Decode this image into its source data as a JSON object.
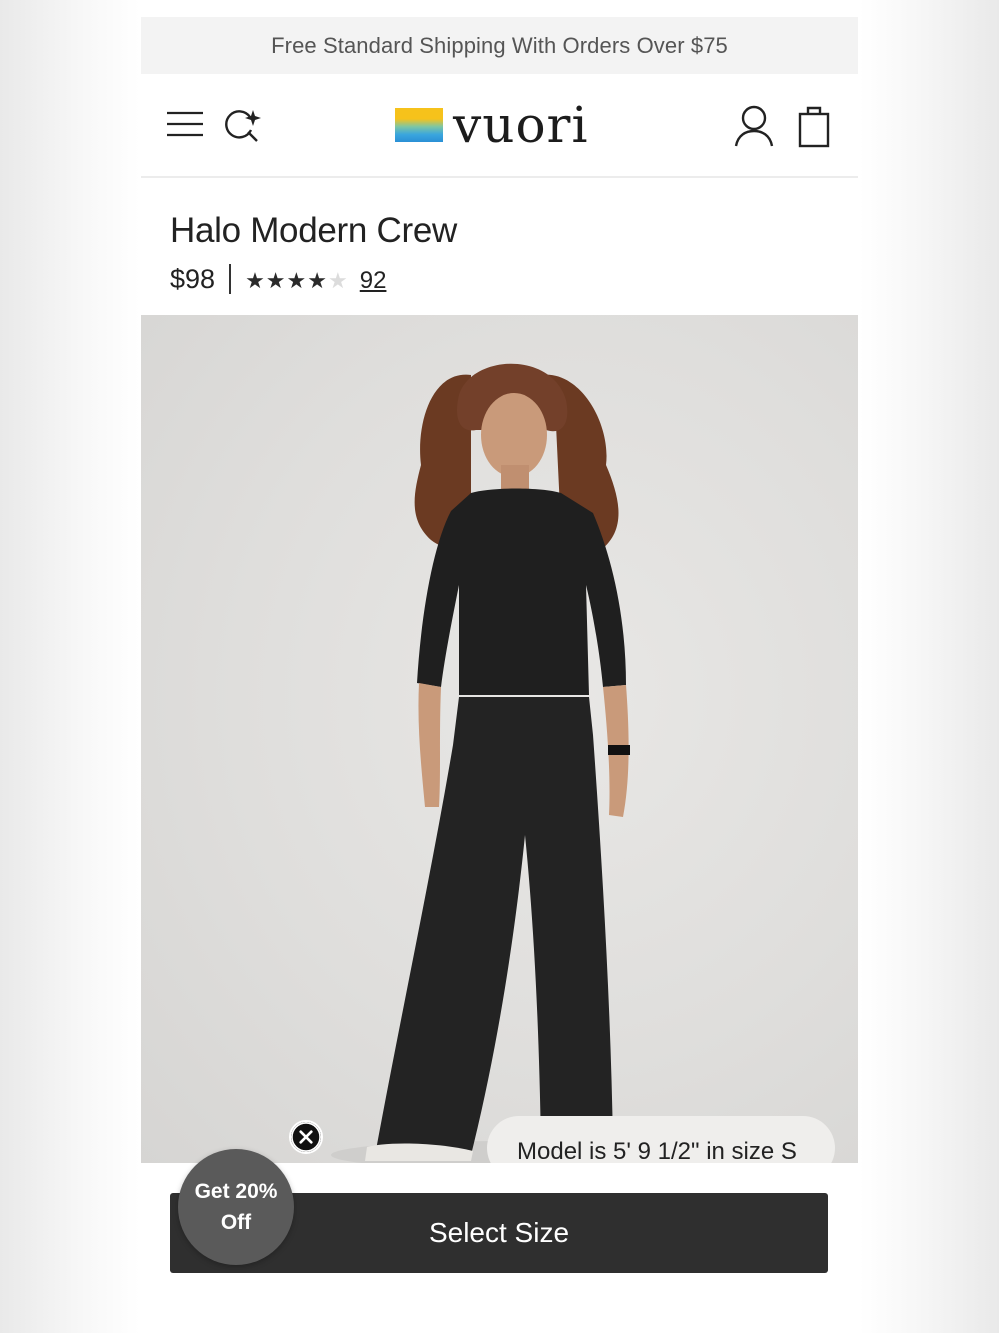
{
  "promo": {
    "text": "Free Standard Shipping With Orders Over $75"
  },
  "header": {
    "logo_text": "vuori"
  },
  "product": {
    "title": "Halo Modern Crew",
    "price": "$98",
    "rating": {
      "value": 4,
      "max": 5,
      "review_count": "92"
    },
    "model_caption": "Model is 5' 9 1/2\" in size S"
  },
  "actions": {
    "select_size_label": "Select Size"
  },
  "discount": {
    "line1": "Get 20%",
    "line2": "Off"
  },
  "colors": {
    "button_bg": "#2f2f2f",
    "badge_bg": "#5a5a5a",
    "logo_yellow": "#f6c21b",
    "logo_blue": "#2a8fd6"
  }
}
